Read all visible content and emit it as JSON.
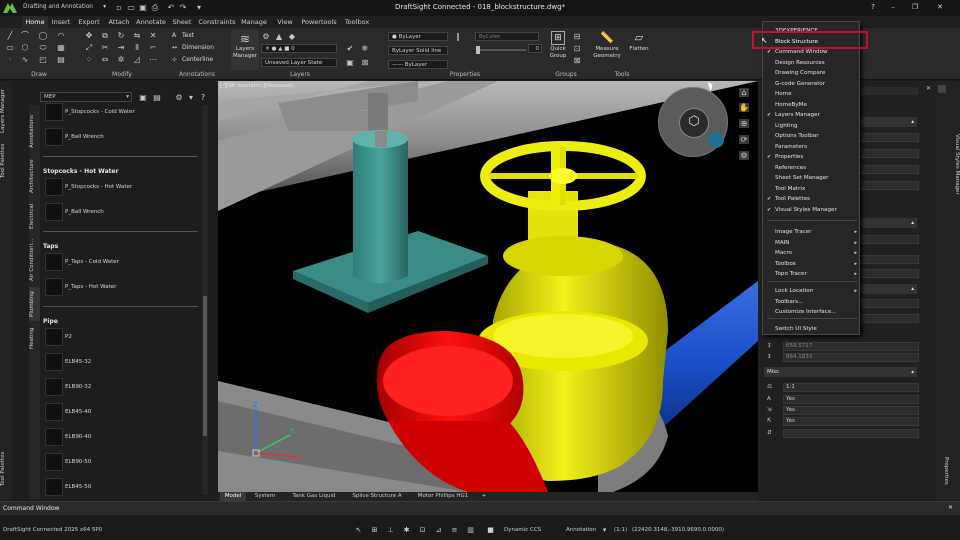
{
  "app": {
    "workspace": "Drafting and Annotation",
    "title": "DraftSight Connected - 018_blockstructure.dwg*",
    "window_controls": [
      "?",
      "–",
      "❐",
      "✕"
    ]
  },
  "ribbon": {
    "tabs": [
      "Home",
      "Insert",
      "Export",
      "Attach",
      "Annotate",
      "Sheet",
      "Constraints",
      "Manage",
      "View",
      "Powertools",
      "Toolbox"
    ],
    "active_tab": "Home",
    "groups": [
      "Draw",
      "Modify",
      "Annotations",
      "Layers",
      "Properties",
      "Groups",
      "Tools"
    ],
    "annotations": {
      "text": "Text",
      "dimension": "Dimension",
      "centerline": "Centerline"
    },
    "layers": {
      "manager": "Layers Manager",
      "state": "Unsaved Layer State",
      "current": "0"
    },
    "properties": {
      "color": "ByLayer",
      "linetype": "ByLayer",
      "lineweight": "ByLayer",
      "linestyle": "Solid line",
      "bycolor": "ByColor",
      "value": "0"
    },
    "groups_btn": "Quick Group",
    "tools": {
      "measure": "Measure Geometry",
      "flatten": "Flatten"
    }
  },
  "left_tabs": [
    "Layers Manager",
    "Tool Palettes",
    "Tool Palettes"
  ],
  "palette": {
    "search": "MEP",
    "categories": [
      "Annotations",
      "Architecture",
      "Electrical",
      "Air Conditioni...",
      "Plumbing",
      "Heating"
    ],
    "groups": [
      {
        "heading": "",
        "items": [
          "P_Stopcocks - Cold Water",
          "P_Ball Wrench"
        ]
      },
      {
        "heading": "Stopcocks - Hot Water",
        "items": [
          "P_Stopcocks - Hot Water",
          "P_Ball Wrench"
        ]
      },
      {
        "heading": "Taps",
        "items": [
          "P_Taps - Cold Water",
          "P_Taps - Hot Water"
        ]
      },
      {
        "heading": "Pipe",
        "items": [
          "P2",
          "ELB45-32",
          "ELB90-32",
          "ELB45-40",
          "ELB90-40",
          "ELB90-50",
          "ELB45-50"
        ]
      }
    ]
  },
  "viewport": {
    "label": "[-][SE Isometric][Gouraud]",
    "axes": [
      "Z",
      "Y",
      "X"
    ]
  },
  "layout_tabs": [
    "Model",
    "System",
    "Tank Gas Liquid",
    "Splice Structure A",
    "Motor Phillips HG1",
    "+"
  ],
  "context_menu": {
    "items": [
      {
        "label": "3DEXPERIENCE",
        "checked": false,
        "submenu": false
      },
      {
        "label": "Block Structure",
        "checked": false,
        "submenu": false
      },
      {
        "label": "Command Window",
        "checked": true,
        "submenu": false
      },
      {
        "label": "Design Resources",
        "checked": false,
        "submenu": false
      },
      {
        "label": "Drawing Compare",
        "checked": false,
        "submenu": false
      },
      {
        "label": "G-code Generator",
        "checked": false,
        "submenu": false
      },
      {
        "label": "Home",
        "checked": false,
        "submenu": false
      },
      {
        "label": "HomeByMe",
        "checked": false,
        "submenu": false
      },
      {
        "label": "Layers Manager",
        "checked": true,
        "submenu": false
      },
      {
        "label": "Lighting",
        "checked": false,
        "submenu": false
      },
      {
        "label": "Options Toolbar",
        "checked": false,
        "submenu": false
      },
      {
        "label": "Parameters",
        "checked": false,
        "submenu": false
      },
      {
        "label": "Properties",
        "checked": true,
        "submenu": false
      },
      {
        "label": "References",
        "checked": false,
        "submenu": false
      },
      {
        "label": "Sheet Set Manager",
        "checked": false,
        "submenu": false
      },
      {
        "label": "Tool Matrix",
        "checked": false,
        "submenu": false
      },
      {
        "label": "Tool Palettes",
        "checked": true,
        "submenu": false
      },
      {
        "label": "Visual Styles Manager",
        "checked": true,
        "submenu": false
      },
      {
        "label": "Image Tracer",
        "checked": false,
        "submenu": true
      },
      {
        "label": "MAIN",
        "checked": false,
        "submenu": true
      },
      {
        "label": "Macro",
        "checked": false,
        "submenu": true
      },
      {
        "label": "Toolbox",
        "checked": false,
        "submenu": true
      },
      {
        "label": "Topo Tracer",
        "checked": false,
        "submenu": true
      },
      {
        "label": "Lock Location",
        "checked": false,
        "submenu": true
      },
      {
        "label": "Toolbars...",
        "checked": false,
        "submenu": false
      },
      {
        "label": "Customize Interface...",
        "checked": false,
        "submenu": false
      },
      {
        "label": "Switch UI Style",
        "checked": false,
        "submenu": false
      }
    ],
    "highlighted": "Block Structure"
  },
  "properties_panel": {
    "coords": [
      "659.5717",
      "864.1833"
    ],
    "misc_heading": "Misc",
    "misc_rows": [
      "1:1",
      "Yes",
      "Yes",
      "Yes"
    ]
  },
  "right_tabs": [
    "Visual Styles Manager",
    "Properties"
  ],
  "command_window": {
    "label": "Command Window"
  },
  "status": {
    "app_version": "DraftSight Connected 2025 x64 SP0",
    "dynamic_ccs": "Dynamic CCS",
    "annotation": "Annotation",
    "scale": "(1:1)",
    "coordinates": "(22420.3148,-3910.9690,0.0000)"
  }
}
